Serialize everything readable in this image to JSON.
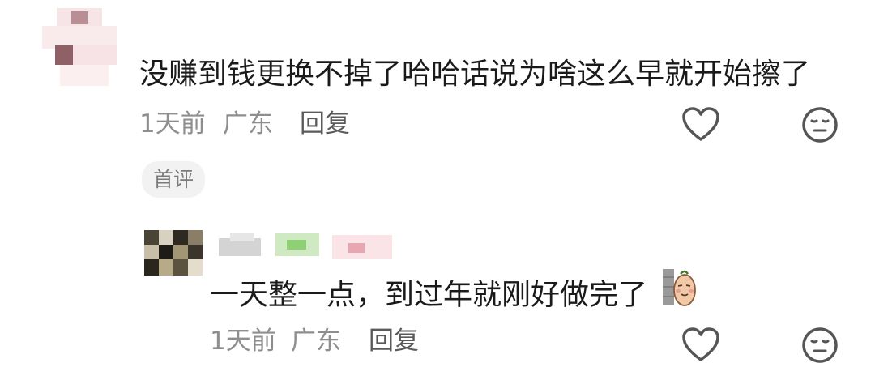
{
  "colors": {
    "text_primary": "#1a1a1a",
    "text_meta": "#8e8e8e",
    "icon_stroke": "#555555",
    "badge_bg": "#f2f2f2"
  },
  "comment": {
    "text": "没赚到钱更换不掉了哈哈话说为啥这么早就开始擦了",
    "time": "1天前",
    "location": "广东",
    "reply_label": "回复",
    "badge": "首评",
    "icons": [
      "heart-icon",
      "neutral-face-icon"
    ]
  },
  "reply": {
    "text": "一天整一点，到过年就刚好做完了",
    "emoji": "peanut-sticker-emoji",
    "time": "1天前",
    "location": "广东",
    "reply_label": "回复",
    "icons": [
      "heart-icon",
      "neutral-face-icon"
    ]
  }
}
